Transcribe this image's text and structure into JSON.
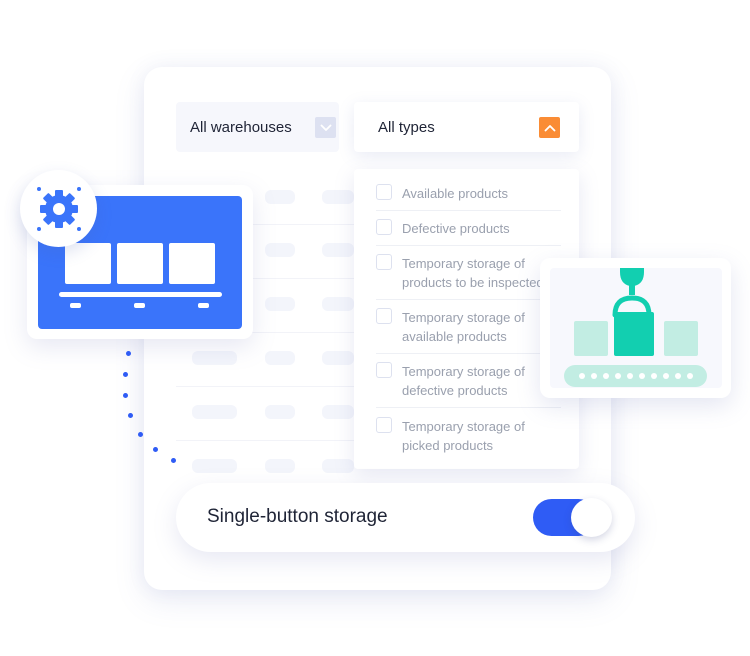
{
  "filters": {
    "warehouse": {
      "label": "All warehouses",
      "icon": "chevron-down-icon"
    },
    "type": {
      "label": "All types",
      "icon": "chevron-up-icon",
      "expanded": true
    }
  },
  "type_options": [
    {
      "label": "Available products",
      "checked": false
    },
    {
      "label": "Defective products",
      "checked": false
    },
    {
      "label": "Temporary storage of\nproducts to be inspected",
      "checked": false
    },
    {
      "label": "Temporary storage of\navailable products",
      "checked": false
    },
    {
      "label": "Temporary storage of\ndefective products",
      "checked": false
    },
    {
      "label": "Temporary storage of\npicked products",
      "checked": false
    }
  ],
  "toggle": {
    "label": "Single-button storage",
    "on": true
  },
  "illustrations": {
    "left": "gear-cart-icon",
    "right": "robot-arm-conveyor-icon"
  },
  "colors": {
    "accent_blue": "#2f5cf5",
    "cart_blue": "#3a74fa",
    "orange": "#fa8c35",
    "teal": "#12cfb0",
    "teal_light": "#c2ede3",
    "text_dark": "#1f2436",
    "text_muted": "#9aa0ae"
  }
}
